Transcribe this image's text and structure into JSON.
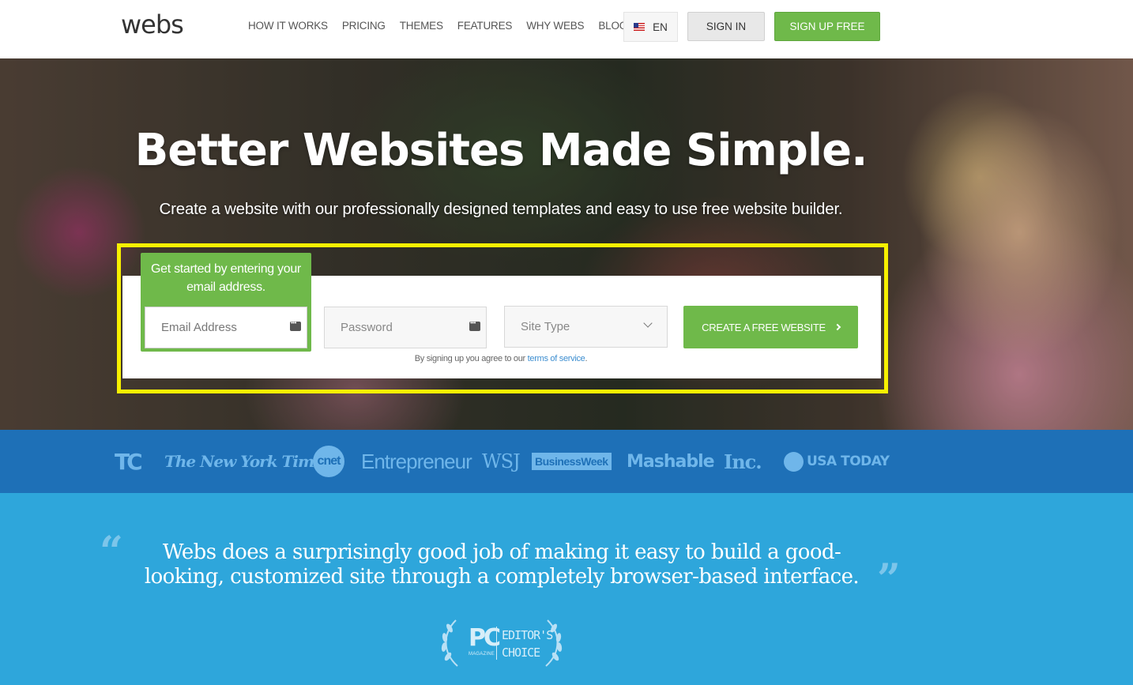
{
  "header": {
    "logo": "webs",
    "nav": [
      "HOW IT WORKS",
      "PRICING",
      "THEMES",
      "FEATURES",
      "WHY WEBS",
      "BLOG"
    ],
    "language": "EN",
    "sign_in": "SIGN IN",
    "sign_up": "SIGN UP FREE"
  },
  "hero": {
    "title": "Better Websites Made Simple.",
    "subtitle": "Create a website with our professionally designed templates and easy to use free website builder.",
    "tip": "Get started by entering your email address.",
    "email_placeholder": "Email Address",
    "password_placeholder": "Password",
    "site_type": "Site Type",
    "cta": "CREATE A FREE WEBSITE",
    "terms_prefix": "By signing up you agree to our ",
    "terms_link": "terms of service",
    "terms_suffix": "."
  },
  "press": {
    "logos": [
      "TC",
      "The New York Times",
      "cnet",
      "Entrepreneur",
      "WSJ",
      "BusinessWeek",
      "Mashable",
      "Inc.",
      "USA TODAY"
    ]
  },
  "quote": {
    "open_mark": "“",
    "close_mark": "”",
    "text": "Webs does a surprisingly good job of making it easy to build a good-looking, customized site through a completely browser-based interface.",
    "badge_pc": "PC",
    "badge_mag": "MAGAZINE",
    "badge_line1": "EDITOR'S",
    "badge_line2": "CHOICE"
  },
  "colors": {
    "accent_green": "#6fb94a",
    "highlight_yellow": "#f7f000",
    "press_blue": "#1e70b7",
    "quote_blue": "#2ea6db"
  }
}
